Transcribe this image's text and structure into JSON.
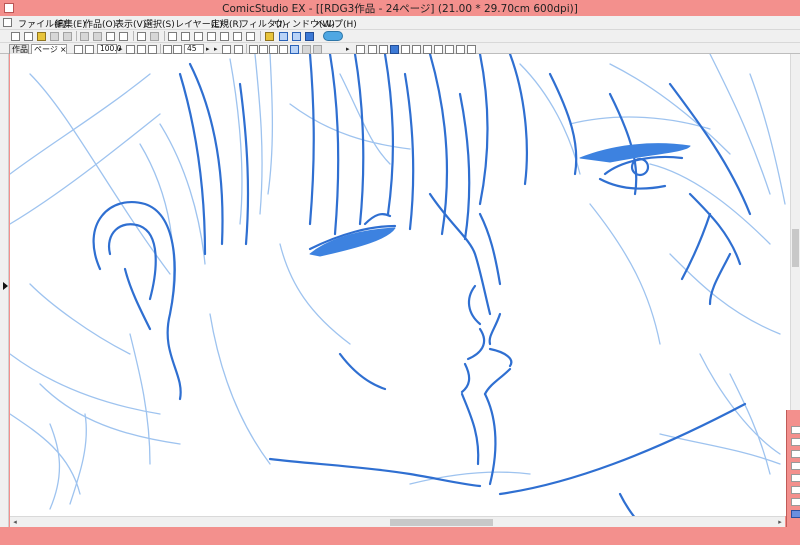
{
  "window": {
    "title": "ComicStudio EX - [[RDG3作品 - 24ページ] (21.00 * 29.70cm 600dpi)]"
  },
  "menu": {
    "items": [
      {
        "label": "ファイル(F)"
      },
      {
        "label": "編集(E)"
      },
      {
        "label": "作品(O)"
      },
      {
        "label": "表示(V)"
      },
      {
        "label": "選択(S)"
      },
      {
        "label": "レイヤー(L)"
      },
      {
        "label": "定規(R)"
      },
      {
        "label": "フィルタ(I)"
      },
      {
        "label": "ウィンドウ(W)"
      },
      {
        "label": "ヘルプ(H)"
      }
    ]
  },
  "tabs": {
    "work_label": "作品",
    "page_label": "ページ",
    "close_symbol": "×"
  },
  "view": {
    "zoom_value": "100.0",
    "rotation_value": "45"
  },
  "colors": {
    "window_frame": "#f3908d",
    "stroke_dark": "#2f6fd1",
    "stroke_light": "#9ec3ef",
    "fill_dark": "#3d82e0"
  }
}
